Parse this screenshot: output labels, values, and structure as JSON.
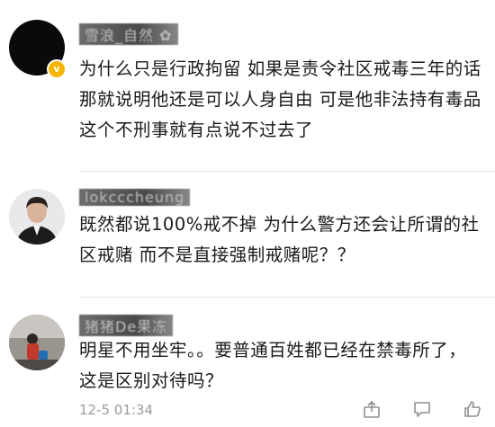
{
  "comments": [
    {
      "username": "雪浪_自然 ✿",
      "text": "为什么只是行政拘留 如果是责令社区戒毒三年的话 那就说明他还是可以人身自由  可是他非法持有毒品 这个不刑事就有点说不过去了",
      "verified_badge": "v"
    },
    {
      "username": "lokcccheung",
      "text": "既然都说100%戒不掉 为什么警方还会让所谓的社区戒赌 而不是直接强制戒赌呢？？"
    },
    {
      "username": "猪猪De果冻",
      "text": "明星不用坐牢。。要普通百姓都已经在禁毒所了，这是区别对待吗？",
      "timestamp": "12-5 01:34"
    }
  ],
  "icons": [
    "share-icon",
    "comment-icon",
    "like-icon"
  ],
  "colors": {
    "text": "#1a1a1a",
    "meta": "#9b9b9b",
    "badge": "#f7b500",
    "divider": "#e6e6e6"
  }
}
